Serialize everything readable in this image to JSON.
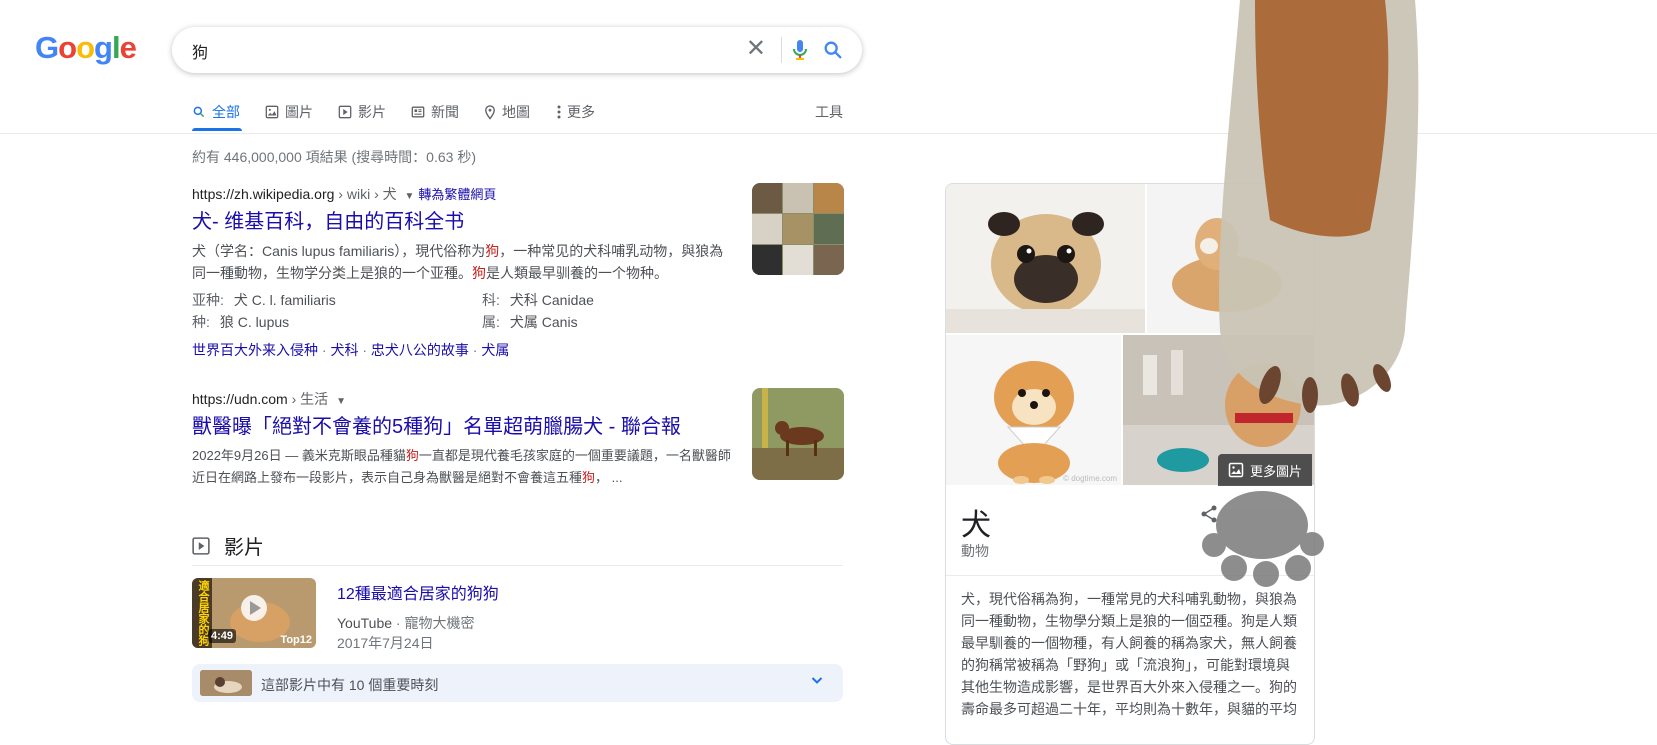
{
  "logo": {
    "text": "Google",
    "colors": [
      "#4285F4",
      "#EA4335",
      "#FBBC05",
      "#4285F4",
      "#34A853",
      "#EA4335"
    ]
  },
  "search": {
    "query": "狗"
  },
  "tabs": [
    {
      "label": "全部",
      "icon": "search-icon",
      "active": true
    },
    {
      "label": "圖片",
      "icon": "image-icon"
    },
    {
      "label": "影片",
      "icon": "play-icon"
    },
    {
      "label": "新聞",
      "icon": "news-icon"
    },
    {
      "label": "地圖",
      "icon": "map-pin-icon"
    },
    {
      "label": "更多",
      "icon": "more-vert-icon"
    }
  ],
  "tools_label": "工具",
  "result_stats": "約有 446,000,000 項結果 (搜尋時間：0.63 秒)",
  "results": [
    {
      "url": "https://zh.wikipedia.org",
      "path": " › wiki › 犬",
      "translate": "轉為繁體網頁",
      "title": "犬- 维基百科，自由的百科全书",
      "snippet_parts": [
        "犬（学名：Canis lupus familiaris），現代俗称为",
        "狗",
        "，一种常见的犬科哺乳动物，與狼為同一種動物，生物学分类上是狼的一个亚種。",
        "狗",
        "是人類最早驯養的一个物种。"
      ],
      "attributes": [
        {
          "k": "亚种:",
          "v": "犬 C. l. familiaris"
        },
        {
          "k": "科:",
          "v": "犬科 Canidae"
        },
        {
          "k": "种:",
          "v": "狼 C. lupus"
        },
        {
          "k": "属:",
          "v": "犬属 Canis"
        }
      ],
      "sitelinks": [
        "世界百大外来入侵种",
        "犬科",
        "忠犬八公的故事",
        "犬属"
      ]
    },
    {
      "url": "https://udn.com",
      "path": " › 生活",
      "title": "獸醫曝「絕對不會養的5種狗」名單超萌臘腸犬 - 聯合報",
      "snippet_parts": [
        "2022年9月26日 — 義米克斯眼品種貓",
        "狗",
        "一直都是現代養毛孩家庭的一個重要議題，一名獸醫師近日在網路上發布一段影片，表示自己身為獸醫是絕對不會養這五種",
        "狗",
        "， ..."
      ]
    }
  ],
  "videos": {
    "heading": "影片",
    "item": {
      "title": "12種最適合居家的狗狗",
      "duration": "4:49",
      "source": "YouTube",
      "channel": "寵物大機密",
      "date": "2017年7月24日",
      "thumb_overlay_left": "適合居家的狗",
      "thumb_overlay_right": "Top12"
    },
    "key_moments": "這部影片中有 10 個重要時刻"
  },
  "knowledge_panel": {
    "title": "犬",
    "subtitle": "動物",
    "more_images": "更多圖片",
    "watermark": "© dogtime.com",
    "description": "犬，現代俗稱為狗，一種常見的犬科哺乳動物，與狼為同一種動物，生物學分類上是狼的一個亞種。狗是人類最早馴養的一個物種，有人飼養的稱為家犬，無人飼養的狗稱常被稱為「野狗」或「流浪狗」，可能對環境與其他生物造成影響，是世界百大外來入侵種之一。狗的壽命最多可超過二十年，平均則為十數年，與貓的平均"
  },
  "colors": {
    "link": "#1a0dab",
    "accent": "#1a73e8",
    "highlight": "#c5221f"
  }
}
